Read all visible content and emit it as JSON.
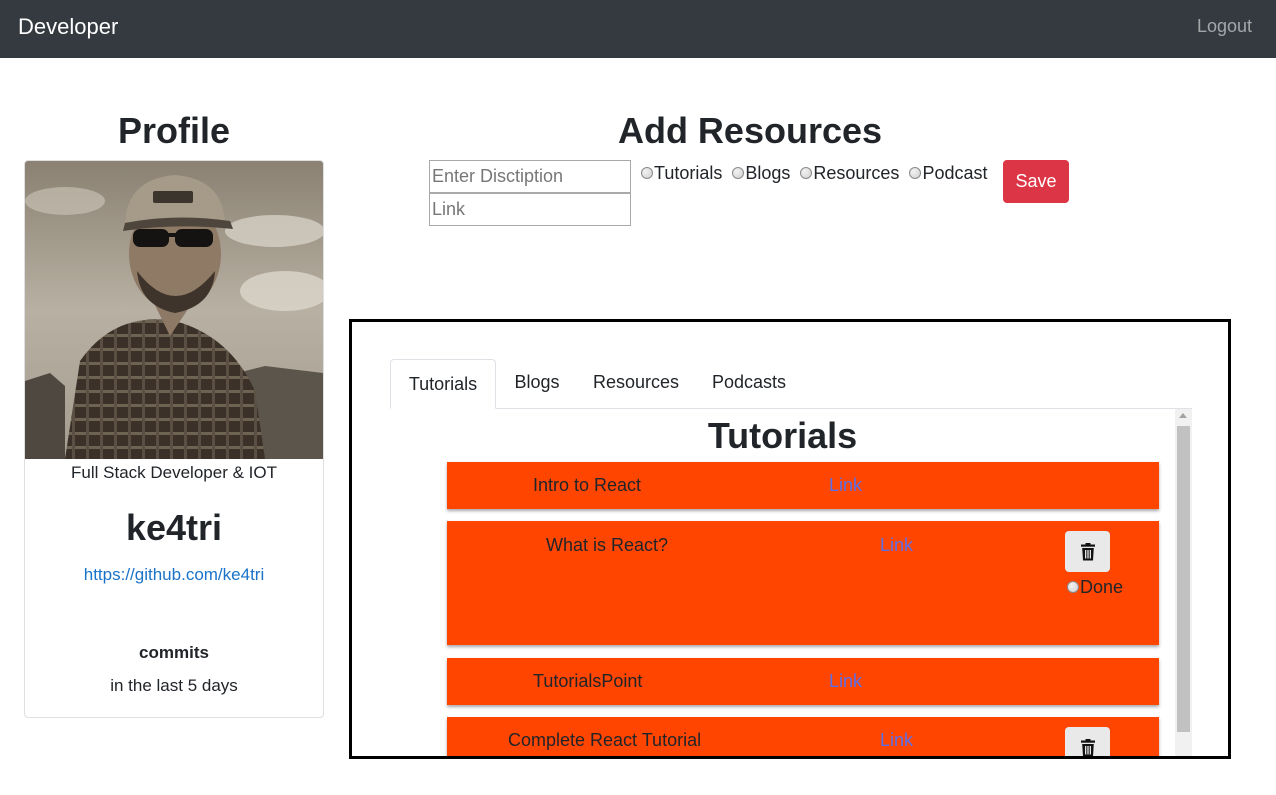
{
  "navbar": {
    "brand": "Developer",
    "logout": "Logout"
  },
  "profile": {
    "title": "Profile",
    "subtitle": "Full Stack Developer & IOT",
    "username": "ke4tri",
    "github": "https://github.com/ke4tri",
    "commits_label": "commits",
    "commits_period": "in the last 5 days"
  },
  "add": {
    "title": "Add Resources",
    "description_placeholder": "Enter Disctiption",
    "link_placeholder": "Link",
    "types": [
      "Tutorials",
      "Blogs",
      "Resources",
      "Podcast"
    ],
    "save": "Save"
  },
  "tabs": [
    "Tutorials",
    "Blogs",
    "Resources",
    "Podcasts"
  ],
  "active_tab": "Tutorials",
  "section_title": "Tutorials",
  "items": [
    {
      "title": "Intro to React",
      "link": "Link"
    },
    {
      "title": "What is React?",
      "link": "Link",
      "done_label": "Done"
    },
    {
      "title": "TutorialsPoint",
      "link": "Link"
    },
    {
      "title": "Complete React Tutorial",
      "link": "Link"
    }
  ],
  "colors": {
    "navbar": "#343a40",
    "card": "#ff4500",
    "save": "#dc3545",
    "link": "#1a73c8"
  },
  "icons": [
    "trash-icon",
    "user-photo"
  ]
}
